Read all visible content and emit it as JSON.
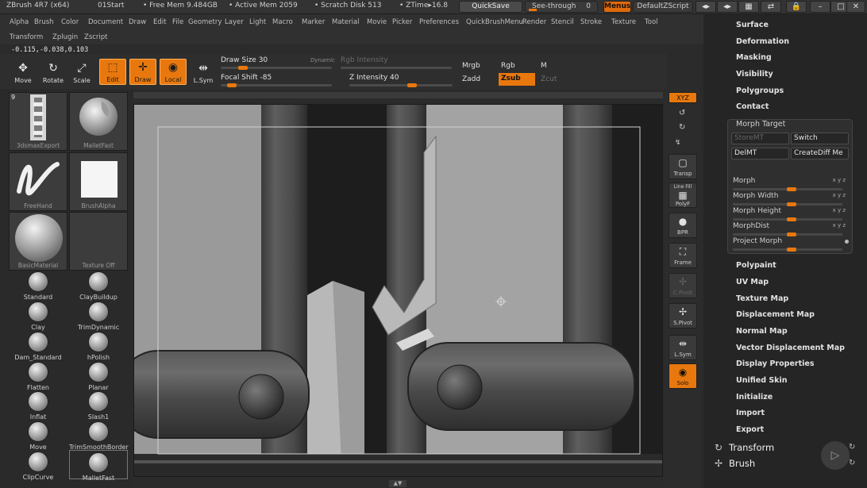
{
  "titlebar": {
    "app": "ZBrush 4R7 (x64)",
    "doc": "01Start",
    "free_mem": "• Free Mem 9.484GB",
    "active_mem": "• Active Mem 2059",
    "scratch": "• Scratch Disk 513",
    "ztime": "• ZTime▸16.8",
    "quicksave": "QuickSave",
    "see_through": "See-through",
    "see_through_value": "0",
    "menus": "Menus",
    "zscript": "DefaultZScript"
  },
  "menubar": {
    "row1": [
      "Alpha",
      "Brush",
      "Color",
      "Document",
      "Draw",
      "Edit",
      "File",
      "Geometry",
      "Layer",
      "Light",
      "Macro",
      "Marker",
      "Material",
      "Movie",
      "Picker",
      "Preferences",
      "QuickBrushMenu",
      "Render",
      "Stencil",
      "Stroke",
      "Texture",
      "Tool"
    ],
    "row2": [
      "Transform",
      "Zplugin",
      "Zscript"
    ]
  },
  "coords": "-0.115,-0.038,0.103",
  "toolbar": {
    "move": "Move",
    "rotate": "Rotate",
    "scale": "Scale",
    "edit": "Edit",
    "draw": "Draw",
    "local": "Local",
    "lsym": "L.Sym",
    "draw_size": "Draw Size 30",
    "dynamic": "Dynamic",
    "focal_shift": "Focal Shift -85",
    "rgb_intensity": "Rgb Intensity",
    "z_intensity": "Z Intensity 40",
    "mrgb": "Mrgb",
    "rgb": "Rgb",
    "m": "M",
    "zadd": "Zadd",
    "zsub": "Zsub",
    "zcut": "Zcut"
  },
  "lefttray": {
    "thumbs": [
      {
        "label": "3dsmaxExport",
        "badge": "9"
      },
      {
        "label": "MalletFast"
      },
      {
        "label": "FreeHand"
      },
      {
        "label": "BrushAlpha"
      },
      {
        "label": "BasicMaterial"
      },
      {
        "label": "Texture Off"
      }
    ],
    "brushes": [
      "Standard",
      "ClayBuildup",
      "Clay",
      "TrimDynamic",
      "Dam_Standard",
      "hPolish",
      "Flatten",
      "Planar",
      "Inflat",
      "Slash1",
      "Move",
      "TrimSmoothBorder",
      "ClipCurve",
      "MalletFast"
    ]
  },
  "shelf": {
    "xyz": "XYZ",
    "transp": "Transp",
    "line_fill": "Line Fill",
    "polyf": "PolyF",
    "bpr": "BPR",
    "frame": "Frame",
    "cpivot": "C.Pivot",
    "spivot": "S.Pivot",
    "lsym": "L.Sym",
    "solo": "Solo"
  },
  "rpanel": {
    "top_items": [
      "Surface",
      "Deformation",
      "Masking",
      "Visibility",
      "Polygroups",
      "Contact"
    ],
    "morph_target": {
      "title": "Morph Target",
      "store_mt": "StoreMT",
      "switch": "Switch",
      "del_mt": "DelMT",
      "create_diff": "CreateDiff Me",
      "sliders": [
        "Morph",
        "Morph Width",
        "Morph Height",
        "MorphDist"
      ],
      "project": "Project Morph",
      "xyz_tag": "x y z"
    },
    "bottom_items": [
      "Polypaint",
      "UV Map",
      "Texture Map",
      "Displacement Map",
      "Normal Map",
      "Vector Displacement Map",
      "Display Properties",
      "Unified Skin",
      "Initialize",
      "Import",
      "Export"
    ],
    "transform": "Transform",
    "brush": "Brush"
  }
}
